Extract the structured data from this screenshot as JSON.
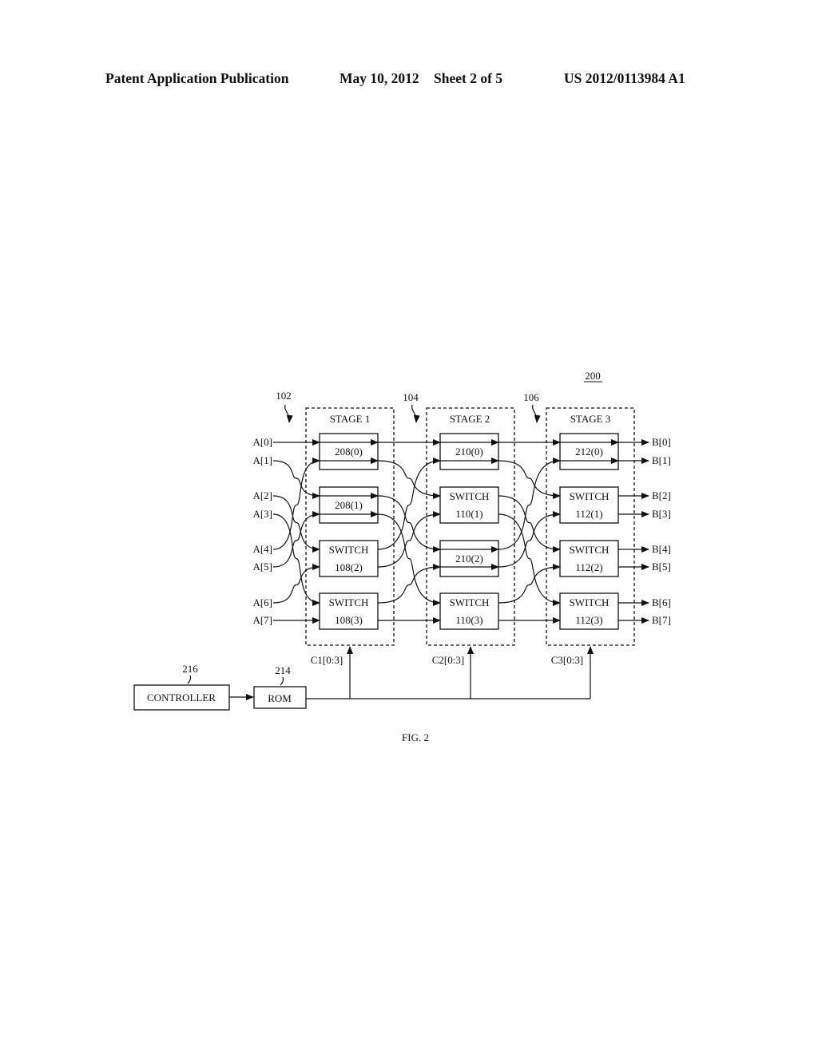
{
  "header": {
    "publication": "Patent Application Publication",
    "date": "May 10, 2012",
    "sheet": "Sheet 2 of 5",
    "number": "US 2012/0113984 A1"
  },
  "figure": {
    "ref": "200",
    "caption": "FIG. 2",
    "stage_refs": [
      "102",
      "104",
      "106"
    ],
    "stages": [
      {
        "label": "STAGE 1",
        "control": "C1[0:3]",
        "blocks": [
          {
            "type": "pass",
            "line1": "",
            "line2": "208(0)"
          },
          {
            "type": "pass",
            "line1": "",
            "line2": "208(1)"
          },
          {
            "type": "switch",
            "line1": "SWITCH",
            "line2": "108(2)"
          },
          {
            "type": "switch",
            "line1": "SWITCH",
            "line2": "108(3)"
          }
        ]
      },
      {
        "label": "STAGE 2",
        "control": "C2[0:3]",
        "blocks": [
          {
            "type": "pass",
            "line1": "",
            "line2": "210(0)"
          },
          {
            "type": "switch",
            "line1": "SWITCH",
            "line2": "110(1)"
          },
          {
            "type": "pass",
            "line1": "",
            "line2": "210(2)"
          },
          {
            "type": "switch",
            "line1": "SWITCH",
            "line2": "110(3)"
          }
        ]
      },
      {
        "label": "STAGE 3",
        "control": "C3[0:3]",
        "blocks": [
          {
            "type": "pass",
            "line1": "",
            "line2": "212(0)"
          },
          {
            "type": "switch",
            "line1": "SWITCH",
            "line2": "112(1)"
          },
          {
            "type": "switch",
            "line1": "SWITCH",
            "line2": "112(2)"
          },
          {
            "type": "switch",
            "line1": "SWITCH",
            "line2": "112(3)"
          }
        ]
      }
    ],
    "inputs": [
      "A[0]",
      "A[1]",
      "A[2]",
      "A[3]",
      "A[4]",
      "A[5]",
      "A[6]",
      "A[7]"
    ],
    "outputs": [
      "B[0]",
      "B[1]",
      "B[2]",
      "B[3]",
      "B[4]",
      "B[5]",
      "B[6]",
      "B[7]"
    ],
    "input_routing": [
      0,
      2,
      4,
      6,
      1,
      3,
      5,
      7
    ],
    "interstage_routing": [
      0,
      2,
      4,
      6,
      1,
      3,
      5,
      7
    ],
    "controller": {
      "label": "CONTROLLER",
      "ref": "216"
    },
    "rom": {
      "label": "ROM",
      "ref": "214"
    }
  }
}
